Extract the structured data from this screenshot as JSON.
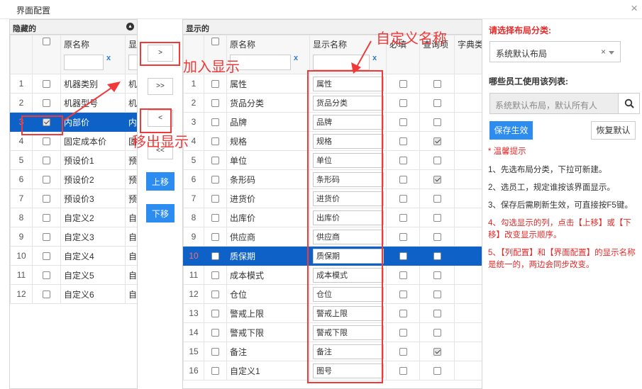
{
  "window": {
    "title": "界面配置",
    "close": "×"
  },
  "hidden": {
    "title": "隐藏的",
    "header": {
      "name": "原名称",
      "display": "显示"
    },
    "clear": "x",
    "rows": [
      {
        "n": "1",
        "name": "机器类别",
        "disp": "机器"
      },
      {
        "n": "2",
        "name": "机器型号",
        "disp": "机器"
      },
      {
        "n": "3",
        "name": "内部价",
        "disp": "内部",
        "checked": true,
        "sel": true
      },
      {
        "n": "4",
        "name": "固定成本价",
        "disp": "固定"
      },
      {
        "n": "5",
        "name": "预设价1",
        "disp": "预设"
      },
      {
        "n": "6",
        "name": "预设价2",
        "disp": "预设"
      },
      {
        "n": "7",
        "name": "预设价3",
        "disp": "预设"
      },
      {
        "n": "8",
        "name": "自定义2",
        "disp": "自定"
      },
      {
        "n": "9",
        "name": "自定义3",
        "disp": "自定"
      },
      {
        "n": "10",
        "name": "自定义4",
        "disp": "自定"
      },
      {
        "n": "11",
        "name": "自定义5",
        "disp": "自定"
      },
      {
        "n": "12",
        "name": "自定义6",
        "disp": "自定"
      }
    ]
  },
  "mid": {
    "add": ">",
    "add_all": ">>",
    "remove": "<",
    "remove_all": "<<",
    "up": "上移",
    "down": "下移"
  },
  "shown": {
    "title": "显示的",
    "header": {
      "name": "原名称",
      "display": "显示名称",
      "required": "必填",
      "query": "查询项",
      "dict": "字典类"
    },
    "clear": "x",
    "rows": [
      {
        "n": "1",
        "name": "属性",
        "disp": "属性",
        "req": false,
        "q": false
      },
      {
        "n": "2",
        "name": "货品分类",
        "disp": "货品分类",
        "req": false,
        "q": false
      },
      {
        "n": "3",
        "name": "品牌",
        "disp": "品牌",
        "req": false,
        "q": false
      },
      {
        "n": "4",
        "name": "规格",
        "disp": "规格",
        "req": false,
        "q": true
      },
      {
        "n": "5",
        "name": "单位",
        "disp": "单位",
        "req": false,
        "q": false
      },
      {
        "n": "6",
        "name": "条形码",
        "disp": "条形码",
        "req": false,
        "q": true
      },
      {
        "n": "7",
        "name": "进货价",
        "disp": "进货价",
        "req": false,
        "q": false
      },
      {
        "n": "8",
        "name": "出库价",
        "disp": "出库价",
        "req": false,
        "q": false
      },
      {
        "n": "9",
        "name": "供应商",
        "disp": "供应商",
        "req": false,
        "q": false
      },
      {
        "n": "10",
        "name": "质保期",
        "disp": "质保期",
        "req": false,
        "q": false,
        "sel": true
      },
      {
        "n": "11",
        "name": "成本模式",
        "disp": "成本模式",
        "req": false,
        "q": false
      },
      {
        "n": "12",
        "name": "仓位",
        "disp": "仓位",
        "req": false,
        "q": false
      },
      {
        "n": "13",
        "name": "警戒上限",
        "disp": "警戒上限",
        "req": false,
        "q": false
      },
      {
        "n": "14",
        "name": "警戒下限",
        "disp": "警戒下限",
        "req": false,
        "q": false
      },
      {
        "n": "15",
        "name": "备注",
        "disp": "备注",
        "req": false,
        "q": true
      },
      {
        "n": "16",
        "name": "自定义1",
        "disp": "图号",
        "req": false,
        "q": false
      }
    ]
  },
  "right": {
    "layout_label": "请选择布局分类:",
    "layout_value": "系统默认布局",
    "clear": "×",
    "emp_label": "哪些员工使用该列表:",
    "emp_placeholder": "系统默认布局，默认所有人",
    "save": "保存生效",
    "restore": "恢复默认",
    "tip_title": "* 温馨提示",
    "tips": [
      "1、先选布局分类，下拉可新建。",
      "2、选员工，规定谁按该界面显示。",
      "3、保存后需刷新生效，可直接按F5键。",
      "4、勾选显示的列，点击【上移】或【下移】改变显示顺序。",
      "5、【列配置】和【界面配置】的显示名称是统一的，两边会同步改变。"
    ]
  },
  "annotations": {
    "add_show": "加入显示",
    "remove_show": "移出显示",
    "custom_name": "自定义名称"
  },
  "colors": {
    "accent": "#2d8cf0",
    "selected_row": "#0e62c7",
    "annotation": "#f03a3a",
    "tip_red": "#e52a2a"
  }
}
